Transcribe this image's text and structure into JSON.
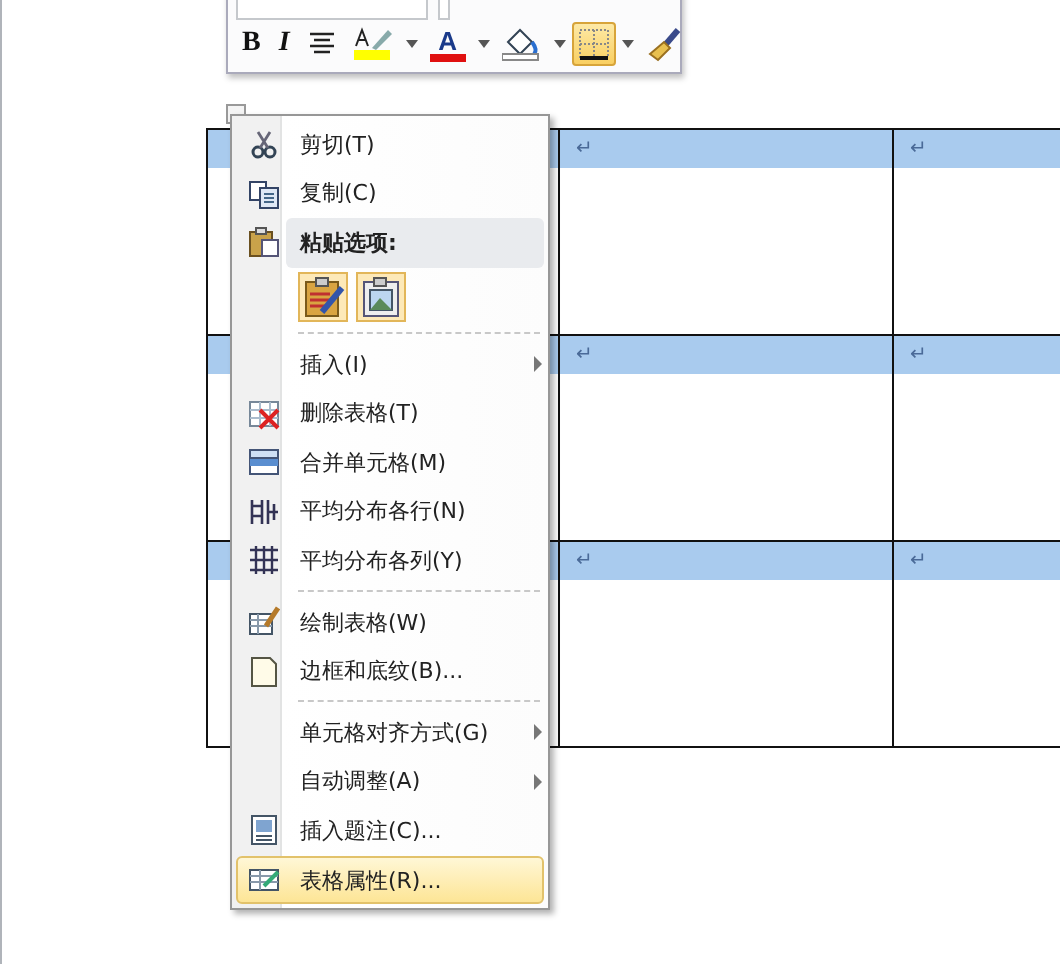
{
  "mini_toolbar": {
    "row_2": [
      {
        "kind": "bold",
        "label": "B",
        "selected": false
      },
      {
        "kind": "italic",
        "label": "I",
        "selected": false
      },
      {
        "kind": "center",
        "selected": false
      },
      {
        "kind": "highlight",
        "selected": false,
        "dropdown": true
      },
      {
        "kind": "font-color",
        "label": "A",
        "selected": false,
        "dropdown": true
      },
      {
        "kind": "shading",
        "selected": false,
        "dropdown": true
      },
      {
        "kind": "borders",
        "selected": true,
        "dropdown": true
      },
      {
        "kind": "format-painter",
        "selected": false
      }
    ]
  },
  "table": {
    "rows": [
      {
        "cells": [
          "↵",
          "↵"
        ]
      },
      {
        "cells": [
          "↵",
          "↵"
        ]
      },
      {
        "cells": [
          "↵",
          "↵"
        ]
      }
    ]
  },
  "context_menu": {
    "items": [
      {
        "kind": "item",
        "label": "剪切(T)",
        "selected": false
      },
      {
        "kind": "item",
        "label": "复制(C)",
        "selected": false
      },
      {
        "kind": "header",
        "label": "粘贴选项:"
      },
      {
        "kind": "paste-options"
      },
      {
        "kind": "separator"
      },
      {
        "kind": "item",
        "label": "插入(I)",
        "submenu": true,
        "selected": false
      },
      {
        "kind": "item",
        "label": "删除表格(T)",
        "selected": false
      },
      {
        "kind": "item",
        "label": "合并单元格(M)",
        "selected": false
      },
      {
        "kind": "item",
        "label": "平均分布各行(N)",
        "selected": false
      },
      {
        "kind": "item",
        "label": "平均分布各列(Y)",
        "selected": false
      },
      {
        "kind": "separator"
      },
      {
        "kind": "item",
        "label": "绘制表格(W)",
        "selected": false
      },
      {
        "kind": "item",
        "label": "边框和底纹(B)...",
        "selected": false
      },
      {
        "kind": "separator"
      },
      {
        "kind": "item",
        "label": "单元格对齐方式(G)",
        "submenu": true,
        "selected": false
      },
      {
        "kind": "item",
        "label": "自动调整(A)",
        "submenu": true,
        "selected": false
      },
      {
        "kind": "item",
        "label": "插入题注(C)...",
        "selected": false
      },
      {
        "kind": "item",
        "label": "表格属性(R)...",
        "selected": true
      }
    ]
  }
}
